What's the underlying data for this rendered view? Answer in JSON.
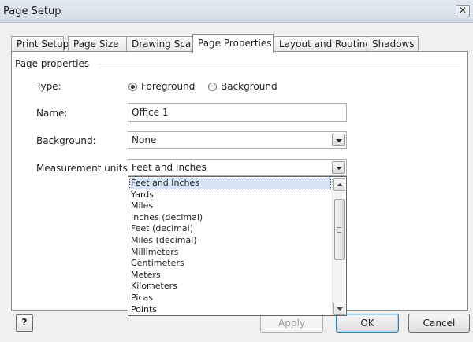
{
  "window": {
    "title": "Page Setup",
    "close_glyph": "✕"
  },
  "tabs": [
    {
      "label": "Print Setup"
    },
    {
      "label": "Page Size"
    },
    {
      "label": "Drawing Scale"
    },
    {
      "label": "Page Properties",
      "active": true
    },
    {
      "label": "Layout and Routing"
    },
    {
      "label": "Shadows"
    }
  ],
  "page_properties": {
    "group_title": "Page properties",
    "type": {
      "label": "Type:",
      "options": [
        "Foreground",
        "Background"
      ],
      "selected": "Foreground"
    },
    "name": {
      "label": "Name:",
      "value": "Office 1"
    },
    "background": {
      "label": "Background:",
      "value": "None"
    },
    "measurement_units": {
      "label": "Measurement units:",
      "value": "Feet and Inches",
      "options": [
        "Feet and Inches",
        "Yards",
        "Miles",
        "Inches (decimal)",
        "Feet (decimal)",
        "Miles (decimal)",
        "Millimeters",
        "Centimeters",
        "Meters",
        "Kilometers",
        "Picas",
        "Points"
      ],
      "highlighted": "Feet and Inches"
    }
  },
  "buttons": {
    "help": "?",
    "apply": "Apply",
    "ok": "OK",
    "cancel": "Cancel"
  },
  "icons": {
    "close": "close-icon",
    "help": "help-icon",
    "dropdown": "chevron-down-icon"
  },
  "colors": {
    "selection": "#d6e4f5",
    "default_button_border": "#3c7fb1"
  }
}
